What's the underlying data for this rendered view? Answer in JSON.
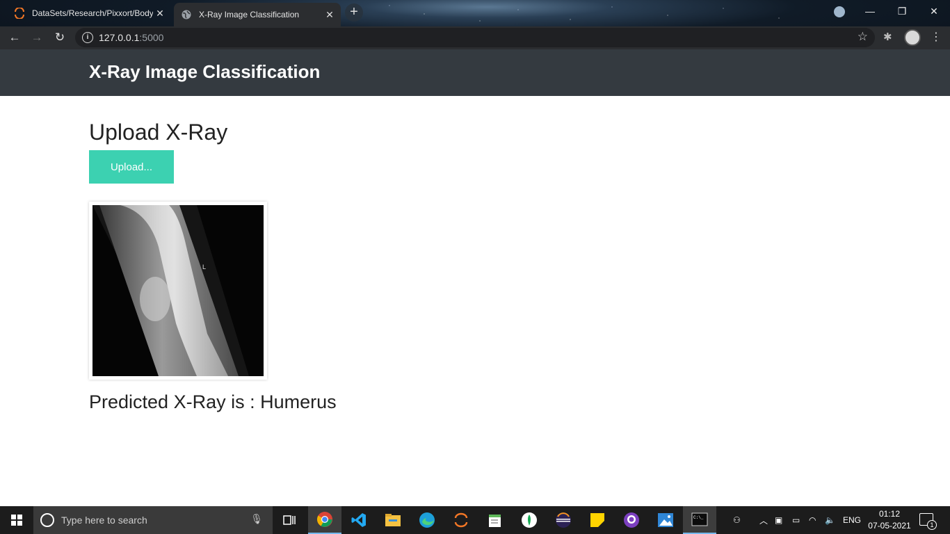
{
  "browser": {
    "tabs": [
      {
        "title": "DataSets/Research/Pixxort/Body",
        "active": false
      },
      {
        "title": "X-Ray Image Classification",
        "active": true
      }
    ],
    "url_host": "127.0.0.1",
    "url_port": ":5000"
  },
  "app": {
    "brand": "X-Ray Image Classification",
    "upload_heading": "Upload X-Ray",
    "upload_button": "Upload...",
    "result_text": "Predicted X-Ray is : Humerus",
    "accent_color": "#3cd1b1",
    "navbar_color": "#343a40"
  },
  "taskbar": {
    "search_placeholder": "Type here to search",
    "language": "ENG",
    "time": "01:12",
    "date": "07-05-2021",
    "notification_count": "1",
    "pinned_icons": [
      "chrome-icon",
      "vscode-icon",
      "file-explorer-icon",
      "edge-icon",
      "jupyter-icon",
      "notepad-icon",
      "mongodb-icon",
      "eclipse-icon",
      "sticky-notes-icon",
      "github-desktop-icon",
      "photos-icon",
      "terminal-icon"
    ]
  }
}
